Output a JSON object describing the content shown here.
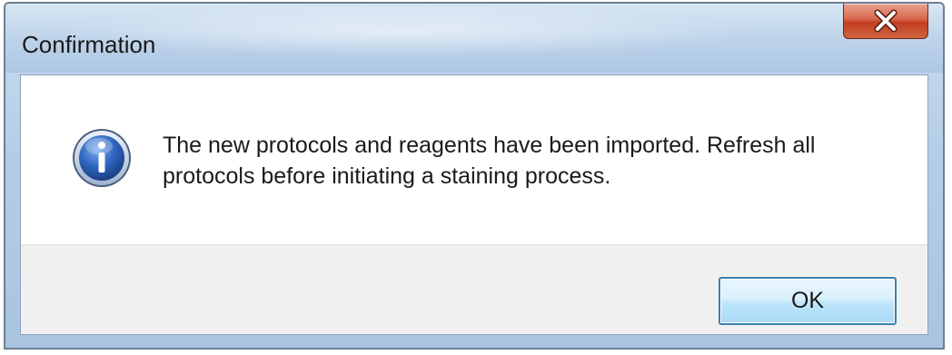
{
  "window": {
    "title": "Confirmation",
    "close_icon": "close-x-icon"
  },
  "dialog": {
    "icon": "information-icon",
    "message": "The new protocols and reagents have been imported. Refresh all protocols before initiating a staining process.",
    "ok_label": "OK"
  },
  "colors": {
    "accent": "#3c7fb1",
    "close_button": "#c23f22",
    "info_icon": "#2a5aa8"
  }
}
